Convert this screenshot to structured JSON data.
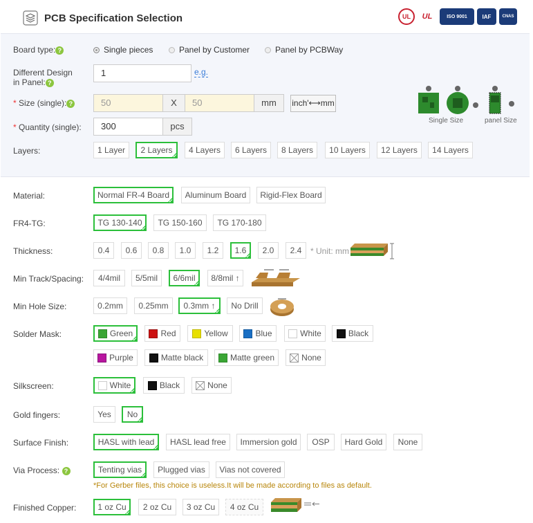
{
  "header": {
    "title": "PCB Specification Selection",
    "certs": [
      "UL",
      "UL",
      "ISO 9001",
      "IAF",
      "CNAS"
    ]
  },
  "board_type": {
    "label": "Board type:",
    "options": [
      "Single pieces",
      "Panel by Customer",
      "Panel by PCBWay"
    ]
  },
  "different_design": {
    "label_line1": "Different Design",
    "label_line2": "in Panel:",
    "value": "1",
    "link": "e.g."
  },
  "size": {
    "label": "Size (single):",
    "req": "*",
    "width": "50",
    "sep": "X",
    "height": "50",
    "unit": "mm",
    "toggle": "inch'⟷mm"
  },
  "quantity": {
    "label": "Quantity (single):",
    "req": "*",
    "value": "300",
    "unit": "pcs"
  },
  "size_images": {
    "single": "Single Size",
    "panel": "panel Size"
  },
  "layers": {
    "label": "Layers:",
    "options": [
      "1 Layer",
      "2 Layers",
      "4 Layers",
      "6 Layers",
      "8 Layers",
      "10 Layers",
      "12 Layers",
      "14 Layers"
    ]
  },
  "material": {
    "label": "Material:",
    "options": [
      "Normal FR-4 Board",
      "Aluminum Board",
      "Rigid-Flex Board"
    ]
  },
  "fr4tg": {
    "label": "FR4-TG:",
    "options": [
      "TG 130-140",
      "TG 150-160",
      "TG 170-180"
    ]
  },
  "thickness": {
    "label": "Thickness:",
    "options": [
      "0.4",
      "0.6",
      "0.8",
      "1.0",
      "1.2",
      "1.6",
      "2.0",
      "2.4"
    ],
    "unit_note": "* Unit: mm"
  },
  "track": {
    "label": "Min Track/Spacing:",
    "options": [
      "4/4mil",
      "5/5mil",
      "6/6mil",
      "8/8mil ↑"
    ]
  },
  "hole": {
    "label": "Min Hole Size:",
    "options": [
      "0.2mm",
      "0.25mm",
      "0.3mm ↑",
      "No Drill"
    ]
  },
  "solder": {
    "label": "Solder Mask:",
    "options": [
      "Green",
      "Red",
      "Yellow",
      "Blue",
      "White",
      "Black",
      "Purple",
      "Matte black",
      "Matte green",
      "None"
    ],
    "colors": [
      "#3aa535",
      "#cc1111",
      "#e8e000",
      "#1a6fc4",
      "#ffffff",
      "#111111",
      "#b8169f",
      "#111111",
      "#3aa535",
      "none"
    ]
  },
  "silkscreen": {
    "label": "Silkscreen:",
    "options": [
      "White",
      "Black",
      "None"
    ]
  },
  "gold": {
    "label": "Gold fingers:",
    "options": [
      "Yes",
      "No"
    ]
  },
  "surface": {
    "label": "Surface Finish:",
    "options": [
      "HASL with lead",
      "HASL lead free",
      "Immersion gold",
      "OSP",
      "Hard Gold",
      "None"
    ]
  },
  "via": {
    "label": "Via Process:",
    "options": [
      "Tenting vias",
      "Plugged vias",
      "Vias not covered"
    ],
    "note": "*For Gerber files, this choice is useless.It will be made according to files as default."
  },
  "copper": {
    "label": "Finished Copper:",
    "options": [
      "1 oz Cu",
      "2 oz Cu",
      "3 oz Cu",
      "4 oz Cu"
    ]
  }
}
